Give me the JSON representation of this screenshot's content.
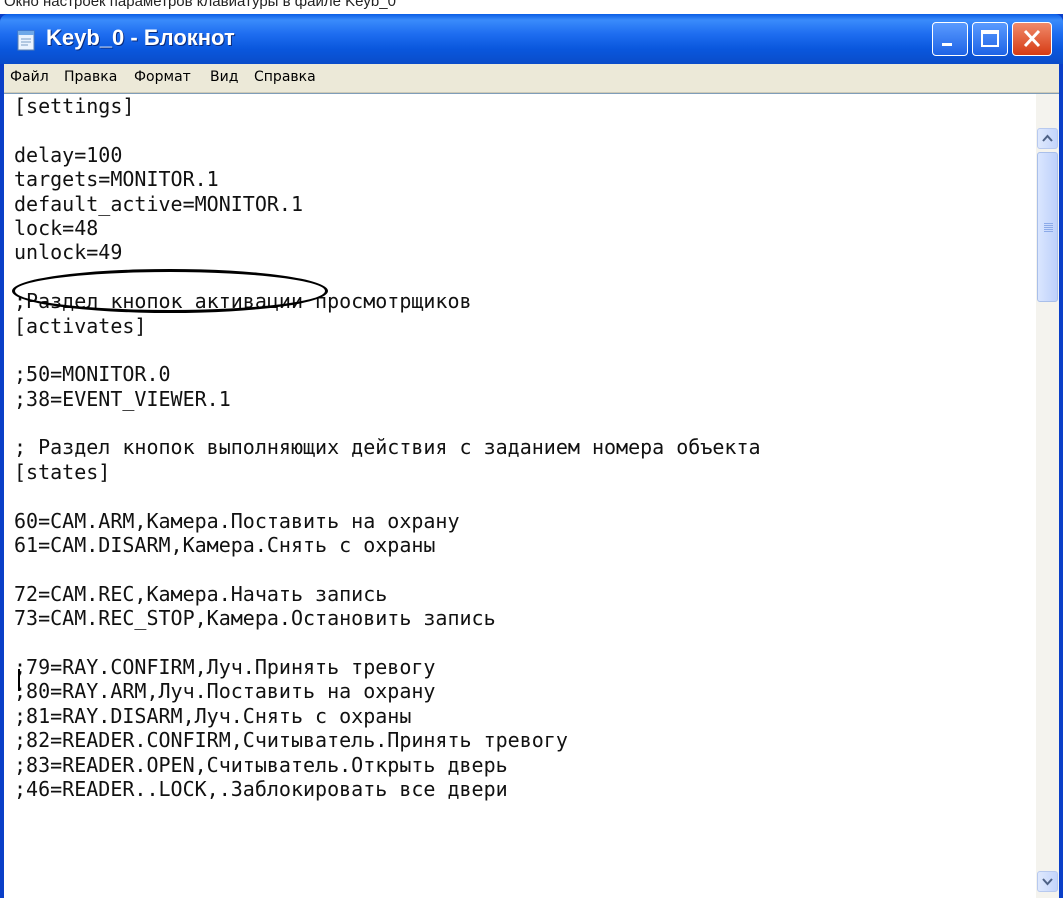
{
  "top_strip": {
    "text": "Окно настроек параметров клавиатуры в файле Keyb_0"
  },
  "window": {
    "title": "Keyb_0 - Блокнот",
    "controls": {
      "minimize": "minimize",
      "maximize": "maximize",
      "close": "close"
    }
  },
  "menu": {
    "items": [
      {
        "label": "Файл"
      },
      {
        "label": "Правка"
      },
      {
        "label": "Формат"
      },
      {
        "label": "Вид"
      },
      {
        "label": "Справка"
      }
    ]
  },
  "editor": {
    "lines": [
      "[settings]",
      "",
      "delay=100",
      "targets=MONITOR.1",
      "default_active=MONITOR.1",
      "lock=48",
      "unlock=49",
      "",
      ";Раздел кнопок активации просмотрщиков",
      "[activates]",
      "",
      ";50=MONITOR.0",
      ";38=EVENT_VIEWER.1",
      "",
      "; Раздел кнопок выполняющих действия с заданием номера объекта",
      "[states]",
      "",
      "60=CAM.ARM,Камера.Поставить на охрану",
      "61=CAM.DISARM,Камера.Снять с охраны",
      "",
      "72=CAM.REC,Камера.Начать запись",
      "73=CAM.REC_STOP,Камера.Остановить запись",
      "",
      ";79=RAY.CONFIRM,Луч.Принять тревогу",
      ";80=RAY.ARM,Луч.Поставить на охрану",
      ";81=RAY.DISARM,Луч.Снять с охраны",
      ";82=READER.CONFIRM,Считыватель.Принять тревогу",
      ";83=READER.OPEN,Считыватель.Открыть дверь",
      ";46=READER..LOCK,.Заблокировать все двери"
    ]
  },
  "annotation": {
    "highlighted_line": "targets=MONITOR.1",
    "color": "#000000"
  },
  "colors": {
    "titlebar": "#0a57dd",
    "menubar": "#ece9d8",
    "close_button": "#d63b14"
  }
}
